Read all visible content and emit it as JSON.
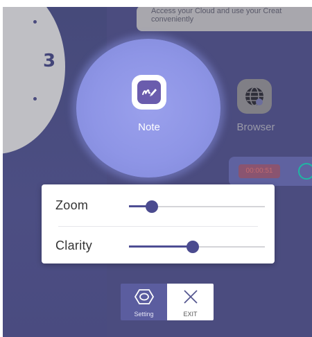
{
  "notification": {
    "line1": "Access your Cloud and use your Creat",
    "line2": "conveniently"
  },
  "dial": {
    "number": "3"
  },
  "apps": [
    {
      "label": "Note",
      "icon": "note-pen-icon",
      "selected": true
    },
    {
      "label": "Browser",
      "icon": "globe-icon",
      "selected": false
    }
  ],
  "timer": {
    "time": "00:00:51"
  },
  "sliders": [
    {
      "label": "Zoom",
      "value_fraction": 0.17
    },
    {
      "label": "Clarity",
      "value_fraction": 0.47
    }
  ],
  "buttons": {
    "setting": {
      "label": "Setting",
      "icon": "hexagon-settings-icon"
    },
    "exit": {
      "label": "EXIT",
      "icon": "close-x-icon"
    }
  },
  "colors": {
    "background": "#4b4c7f",
    "accent": "#5b5d9f",
    "highlight": "#8e95e6",
    "slider_thumb": "#4b4b8f"
  }
}
